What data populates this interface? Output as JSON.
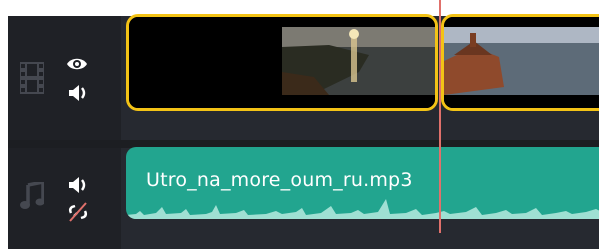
{
  "timeline": {
    "video_track": {
      "type_icon": "film-strip-icon",
      "controls": [
        "eye-icon",
        "speaker-icon"
      ],
      "clips": [
        {
          "name": "sunset-sea-clip",
          "selected": true
        },
        {
          "name": "church-sea-clip",
          "selected": true
        }
      ]
    },
    "audio_track": {
      "type_icon": "music-note-icon",
      "controls": [
        "speaker-icon",
        "unlink-icon"
      ],
      "clip": {
        "filename": "Utro_na_more_oum_ru.mp3"
      }
    },
    "colors": {
      "background": "#1f2126",
      "lane": "#262930",
      "selection": "#f3c316",
      "audio_clip": "#22a58f",
      "playhead": "#e0706b"
    }
  }
}
